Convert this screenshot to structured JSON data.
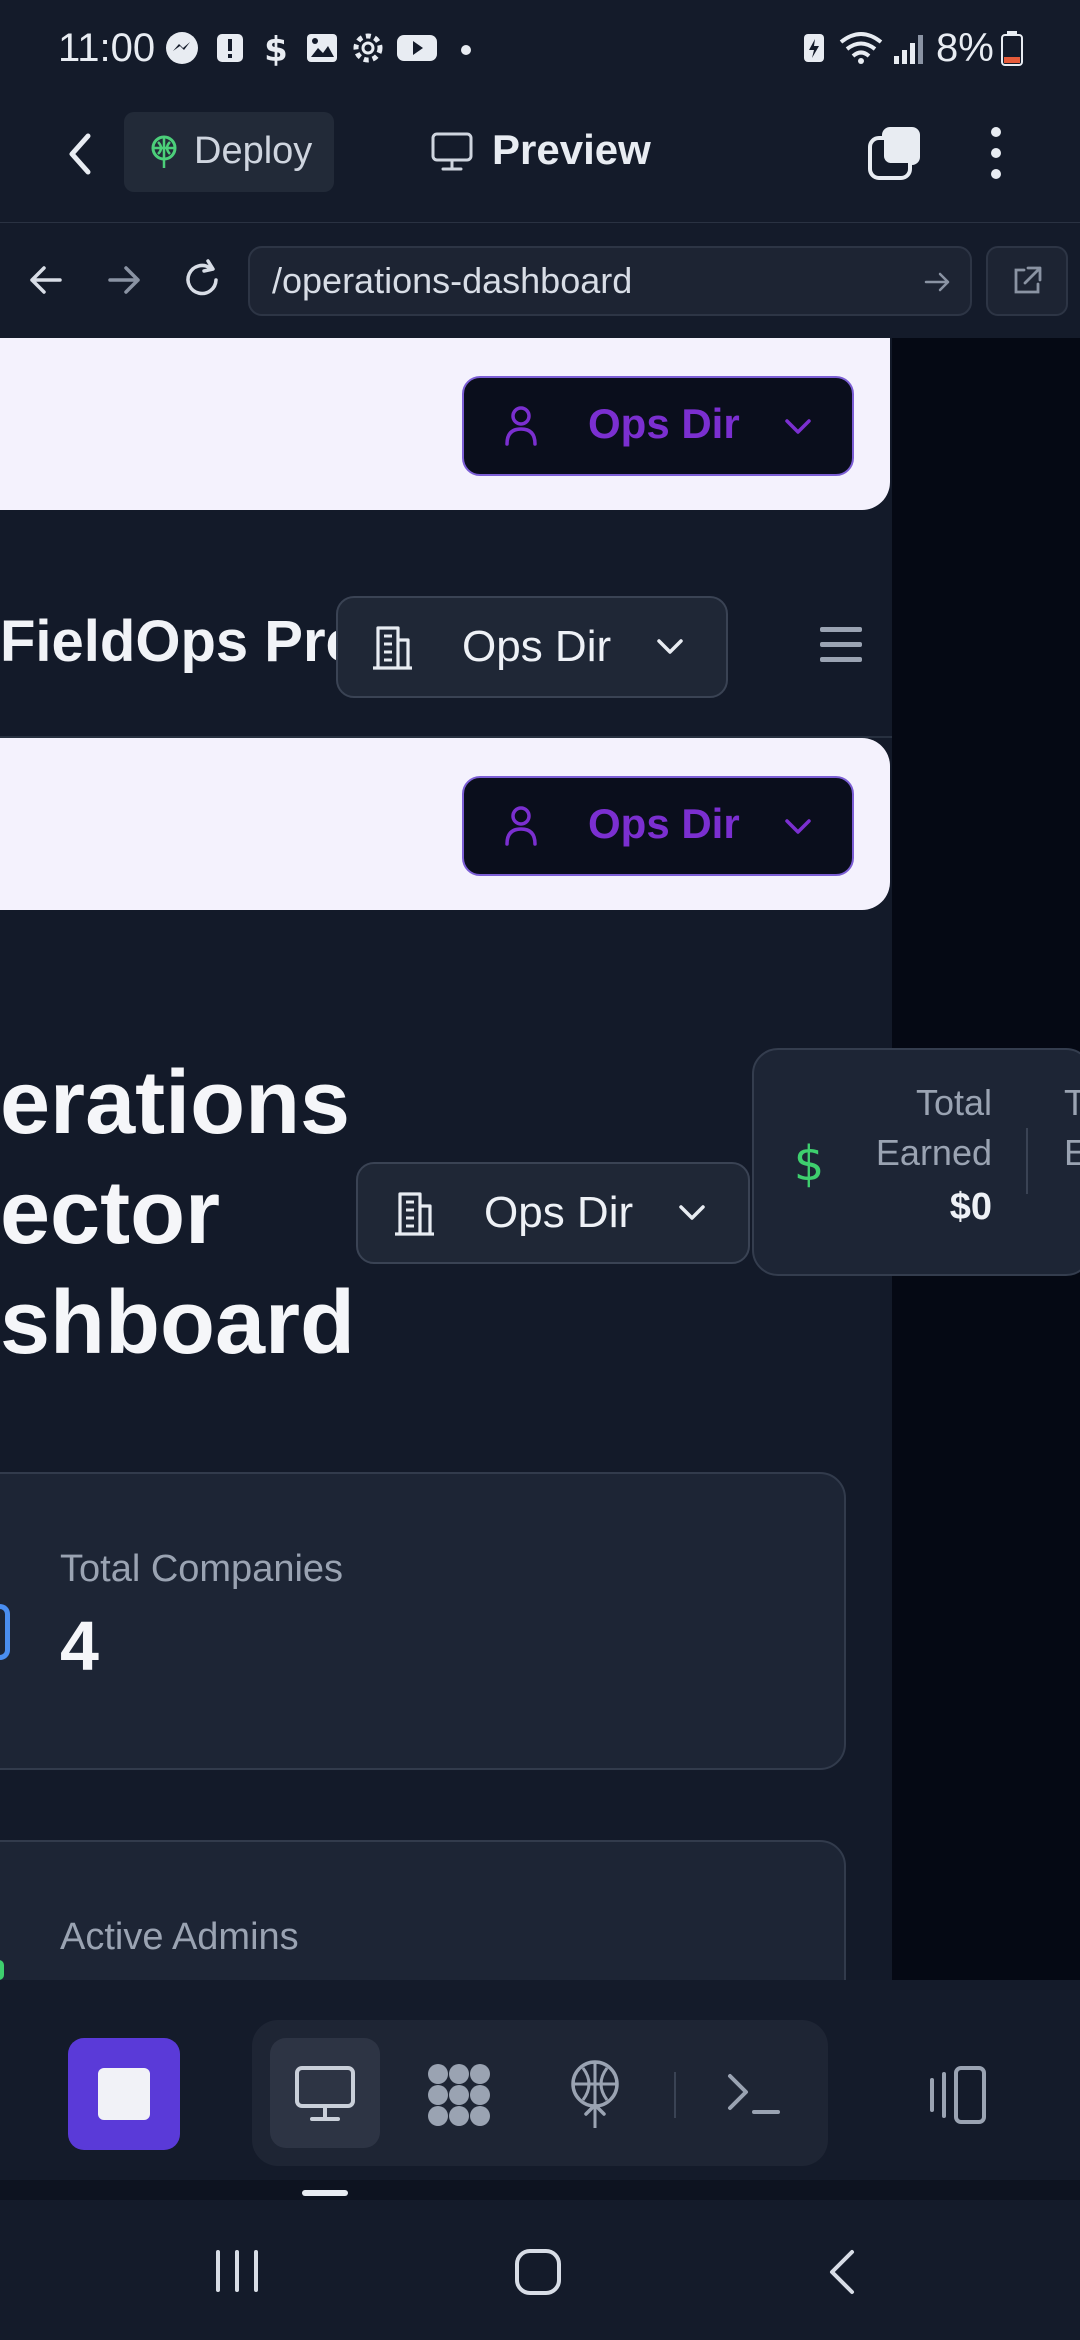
{
  "status_bar": {
    "time": "11:00",
    "battery": "8%",
    "icons": [
      "messenger-icon",
      "alert-icon",
      "dollar-icon",
      "image-icon",
      "settings-icon",
      "youtube-icon",
      "dot-icon",
      "battery-saver-icon",
      "wifi-icon",
      "signal-icon",
      "battery-icon"
    ]
  },
  "app_header": {
    "deploy_label": "Deploy",
    "preview_label": "Preview"
  },
  "browser": {
    "url": "/operations-dashboard"
  },
  "page": {
    "role_selector_label": "Ops Dir",
    "brand_title": "FieldOps Pro",
    "dashboard_title_lines": [
      "erations",
      "ector",
      "shboard"
    ],
    "earnings": {
      "label_line1": "Total",
      "label_line2": "Earned",
      "value": "$0",
      "next_label_line1": "T",
      "next_label_line2": "E"
    },
    "stats": [
      {
        "label": "Total Companies",
        "value": "4"
      },
      {
        "label": "Active Admins",
        "value": ""
      }
    ]
  },
  "colors": {
    "accent_purple": "#7b2fd0",
    "stop_button": "#5a3ad8",
    "earn_green": "#3ecf6e",
    "deploy_green": "#4ccf7a",
    "stat_blue": "#4a8ef0"
  }
}
